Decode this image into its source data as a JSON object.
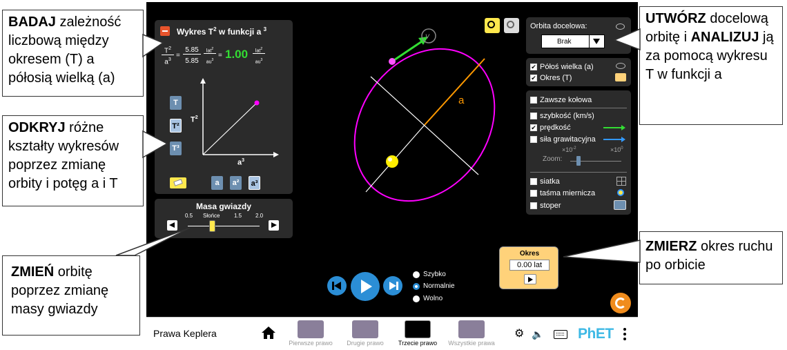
{
  "callouts": {
    "badaj": {
      "bold": "BADAJ",
      "text": " zależność liczbową między okresem (T) a półosią wielką (a)"
    },
    "odkryj": {
      "bold": "ODKRYJ",
      "text": " różne kształty wykresów poprzez zmianę orbity i potęg a i T"
    },
    "zmien": {
      "bold": "ZMIEŃ",
      "text": " orbitę poprzez zmianę masy gwiazdy"
    },
    "utworz": {
      "bold1": "UTWÓRZ",
      "text1": " docelową orbitę i ",
      "bold2": "ANALIZUJ",
      "text2": " ją za pomocą wykresu T w funkcji a"
    },
    "zmierz": {
      "bold": "ZMIERZ",
      "text": " okres ruchu po orbicie"
    }
  },
  "graph_panel": {
    "title": "Wykres T",
    "title_sup1": "2",
    "title_mid": " w funkcji a",
    "title_sup2": "3",
    "eq_T": "T",
    "eq_T_sup": "2",
    "eq_a": "a",
    "eq_a_sup": "3",
    "eq_num": "5.85",
    "eq_den": "5.85",
    "unit_num": "lat",
    "unit_num_sup": "2",
    "unit_den": "au",
    "unit_den_sup": "3",
    "eq_result": "1.00",
    "y_axis_label": "T",
    "y_axis_sup": "2",
    "x_axis_label": "a",
    "x_axis_sup": "3",
    "t_buttons": [
      "T",
      "T²",
      "T³"
    ],
    "a_buttons": [
      "a",
      "a²",
      "a³"
    ]
  },
  "mass_panel": {
    "title": "Masa gwiazdy",
    "ticks": [
      "0.5",
      "Słońce",
      "1.5",
      "2.0"
    ],
    "value": 1.0
  },
  "orbit_panel": {
    "label": "Orbita docelowa:",
    "selected": "Brak"
  },
  "axes_panel": {
    "items": [
      {
        "label": "Półoś wielka (a)",
        "checked": true
      },
      {
        "label": "Okres (T)",
        "checked": true
      }
    ]
  },
  "options_panel": {
    "always_circular": "Zawsze kołowa",
    "speed": "szybkość (km/s)",
    "velocity": "prędkość",
    "gravity": "siła grawitacyjna",
    "zoom_label": "Zoom:",
    "zoom_min": "×10",
    "zoom_min_exp": "-2",
    "zoom_max": "×10",
    "zoom_max_exp": "0",
    "grid": "siatka",
    "tape": "taśma miernicza",
    "stopwatch": "stoper"
  },
  "orbit_view": {
    "semi_major_label": "a",
    "velocity_label": "v"
  },
  "period_box": {
    "title": "Okres",
    "value": "0.00 lat"
  },
  "time_controls": {
    "options": [
      "Szybko",
      "Normalnie",
      "Wolno"
    ],
    "selected": "Normalnie"
  },
  "navbar": {
    "title": "Prawa Keplera",
    "screens": [
      {
        "label": "Pierwsze prawo",
        "active": false
      },
      {
        "label": "Drugie prawo",
        "active": false
      },
      {
        "label": "Trzecie prawo",
        "active": true
      },
      {
        "label": "Wszystkie prawa",
        "active": false
      }
    ],
    "logo": "PhET"
  },
  "colors": {
    "orbit": "#ff00ff",
    "star": "#ffff00",
    "semi_major": "#ff9900",
    "velocity": "#33dd33",
    "gravity": "#3399ff",
    "result": "#33dd33",
    "period_box": "#ffd27a"
  }
}
